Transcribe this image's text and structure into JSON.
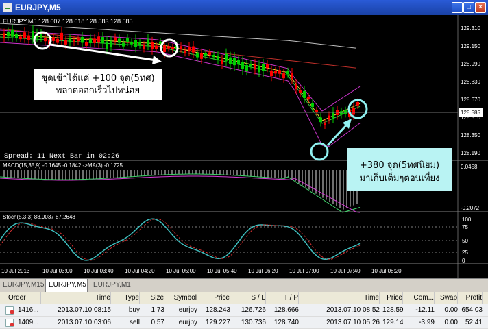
{
  "window": {
    "title": "EURJPY,M5"
  },
  "chart": {
    "symbol_line": "EURJPY,M5  128.607 128.618 128.583 128.585",
    "spread_line": "Spread: 11  Next Bar in 02:26",
    "price_levels": [
      "129.310",
      "129.150",
      "128.990",
      "128.830",
      "128.670",
      "128.510",
      "128.350",
      "128.190"
    ],
    "current_price": "128.585",
    "annotation_left": [
      "ชุดเข้าได้แค่ +100 จุด(5ทศ)",
      "พลาดออกเร็วไปหน่อย"
    ],
    "annotation_right": [
      "+380 จุด(5ทศนิยม)",
      "มาเก็บเต็มๆตอนเที่ยง"
    ],
    "macd_label": "MACD(15,35,9) -0.1645 -0.1842 ->MA(3) -0.1725",
    "macd_levels": [
      "0.0458",
      "-0.2072"
    ],
    "stoch_label": "Stoch(5,3,3) 88.9037 87.2648",
    "stoch_levels": [
      "100",
      "75",
      "50",
      "25",
      "0"
    ],
    "time_labels": [
      "10 Jul 2013",
      "10 Jul 03:00",
      "10 Jul 03:40",
      "10 Jul 04:20",
      "10 Jul 05:00",
      "10 Jul 05:40",
      "10 Jul 06:20",
      "10 Jul 07:00",
      "10 Jul 07:40",
      "10 Jul 08:20"
    ]
  },
  "tabs": [
    "EURJPY,M15",
    "EURJPY,M5",
    "EURJPY,M1"
  ],
  "active_tab": "EURJPY,M5",
  "table": {
    "headers": [
      "Order",
      "Time",
      "Type",
      "Size",
      "Symbol",
      "Price",
      "S / L",
      "T / P",
      "Time",
      "Price",
      "Com...",
      "Swap",
      "Profit"
    ],
    "rows": [
      [
        "1416...",
        "2013.07.10 08:15",
        "buy",
        "1.73",
        "eurjpy",
        "128.243",
        "126.726",
        "128.666",
        "2013.07.10 08:52",
        "128.593",
        "-12.11",
        "0.00",
        "654.03"
      ],
      [
        "1409...",
        "2013.07.10 03:06",
        "sell",
        "0.57",
        "eurjpy",
        "129.227",
        "130.736",
        "128.740",
        "2013.07.10 05:26",
        "129.142",
        "-3.99",
        "0.00",
        "52.41"
      ]
    ]
  },
  "colors": {
    "bull": "#00d000",
    "bear": "#ff0000",
    "macd": "#3fd46b",
    "signal": "#d63ad6",
    "stoch": "#3fbfbf",
    "annotation_box": "#b9f3f3"
  }
}
